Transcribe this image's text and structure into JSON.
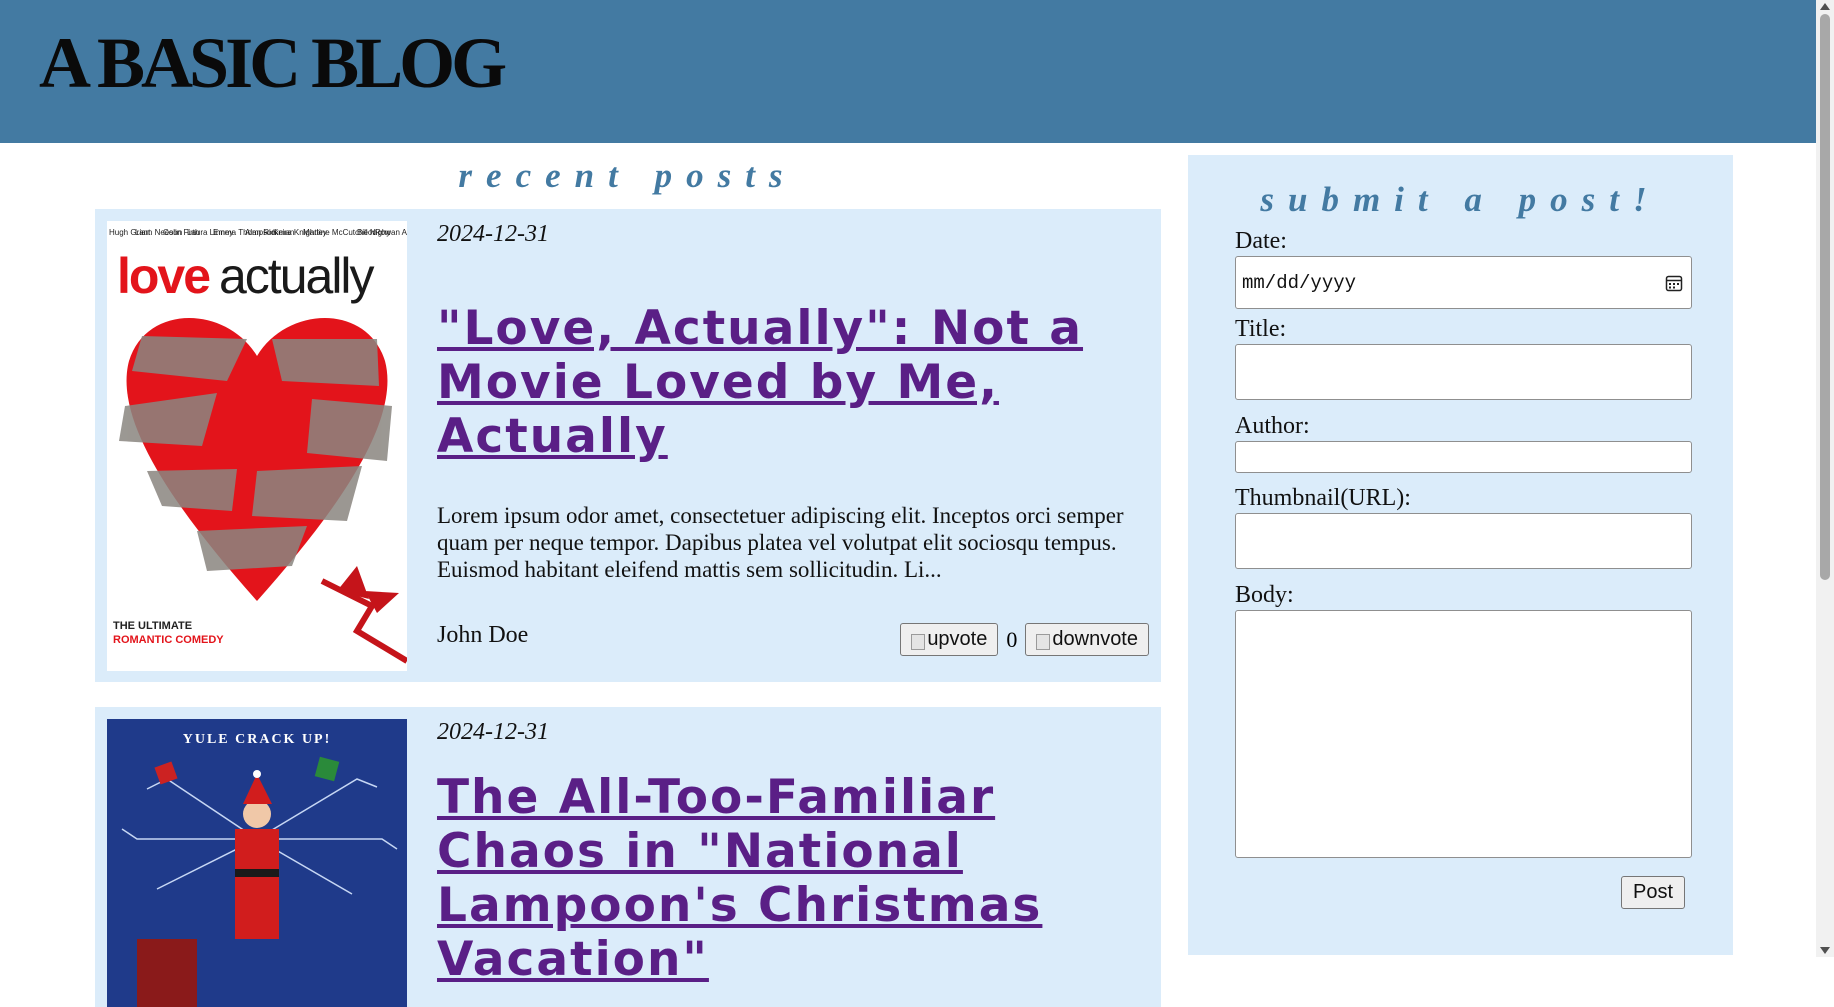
{
  "header": {
    "title": "A BASIC BLOG"
  },
  "recent": {
    "heading": "recent posts"
  },
  "posts": [
    {
      "date": "2024-12-31",
      "title": "\"Love, Actually\": Not a Movie Loved by Me, Actually",
      "excerpt": "Lorem ipsum odor amet, consectetuer adipiscing elit. Inceptos orci semper quam per neque tempor. Dapibus platea vel volutpat elit sociosqu tempus. Euismod habitant eleifend mattis sem sollicitudin. Li...",
      "author": "John Doe",
      "upvote_label": "upvote",
      "downvote_label": "downvote",
      "votes": "0",
      "poster": {
        "cast": [
          "Hugh Grant",
          "Liam Neeson",
          "Colin Firth",
          "Laura Linney",
          "Emma Thompson",
          "Alan Rickman",
          "Keira Knightley",
          "Martine McCutcheon",
          "Bill Nighy",
          "Rowan Atkinson"
        ],
        "title_love": "love",
        "title_actually": "actually",
        "tagline_1": "THE ULTIMATE",
        "tagline_2": "ROMANTIC COMEDY",
        "heart_color": "#e3141b"
      }
    },
    {
      "date": "2024-12-31",
      "title": "The All-Too-Familiar Chaos in \"National Lampoon's Christmas Vacation\"",
      "poster": {
        "tagline": "YULE CRACK UP!"
      }
    }
  ],
  "form": {
    "heading": "submit a post!",
    "date_label": "Date:",
    "date_placeholder": "mm/dd/yyyy",
    "title_label": "Title:",
    "author_label": "Author:",
    "thumbnail_label": "Thumbnail(URL):",
    "body_label": "Body:",
    "submit_label": "Post"
  },
  "colors": {
    "header": "#437aa2",
    "card": "#dbecfa",
    "link": "#5a1f86"
  }
}
